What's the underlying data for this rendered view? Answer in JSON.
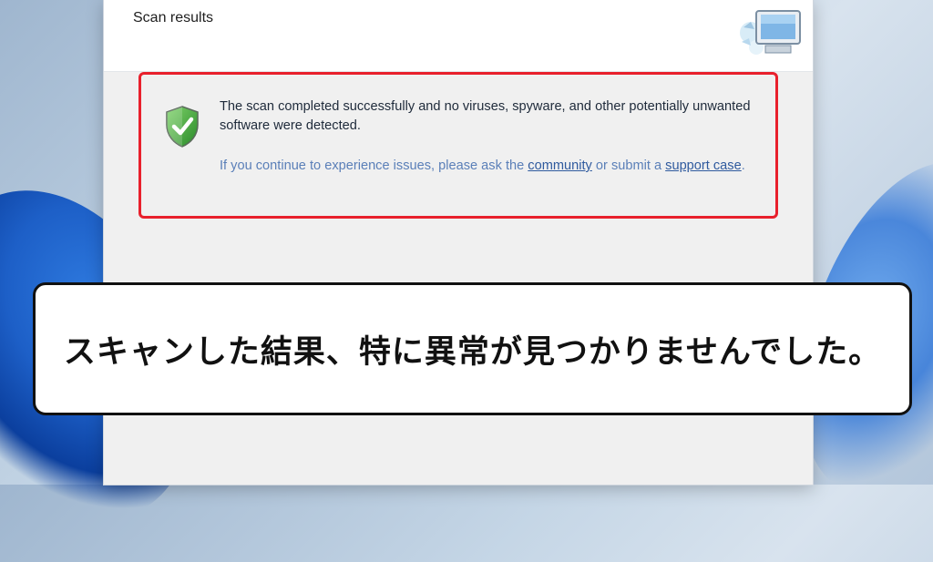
{
  "window": {
    "title": "Scan results",
    "header_icon": "scanner-computer-icon"
  },
  "result": {
    "status_icon": "shield-check-icon",
    "message": "The scan completed successfully and no viruses, spyware, and other potentially unwanted software were detected.",
    "help_prefix": "If you continue to experience issues, please ask the ",
    "community_link": "community",
    "help_middle": " or submit a ",
    "support_link": "support case",
    "help_suffix": "."
  },
  "caption": {
    "text": "スキャンした結果、特に異常が見つかりませんでした。"
  },
  "colors": {
    "highlight_border": "#e8202c",
    "shield_green": "#3aa53a",
    "link": "#2f5a9e"
  }
}
